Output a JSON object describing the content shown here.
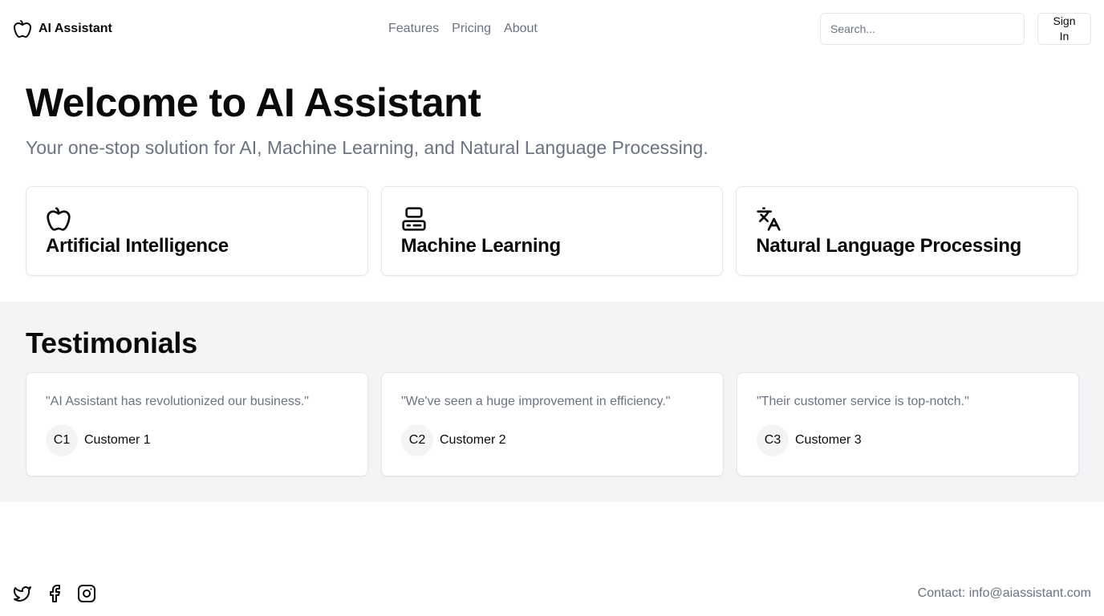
{
  "header": {
    "brand_name": "AI Assistant",
    "brand_icon": "apple-icon",
    "nav": [
      "Features",
      "Pricing",
      "About"
    ],
    "search_placeholder": "Search...",
    "signin_label": "Sign In"
  },
  "hero": {
    "title": "Welcome to AI Assistant",
    "subtitle": "Your one-stop solution for AI, Machine Learning, and Natural Language Processing."
  },
  "features": [
    {
      "icon": "apple-icon",
      "title": "Artificial Intelligence"
    },
    {
      "icon": "computer-icon",
      "title": "Machine Learning"
    },
    {
      "icon": "translate-icon",
      "title": "Natural Language Processing"
    }
  ],
  "testimonials": {
    "title": "Testimonials",
    "items": [
      {
        "quote": "\"AI Assistant has revolutionized our business.\"",
        "initials": "C1",
        "name": "Customer 1"
      },
      {
        "quote": "\"We've seen a huge improvement in efficiency.\"",
        "initials": "C2",
        "name": "Customer 2"
      },
      {
        "quote": "\"Their customer service is top-notch.\"",
        "initials": "C3",
        "name": "Customer 3"
      }
    ]
  },
  "footer": {
    "socials": [
      "twitter-icon",
      "facebook-icon",
      "instagram-icon"
    ],
    "contact": "Contact: info@aiassistant.com"
  },
  "colors": {
    "text": "#0a0a0a",
    "muted": "#6b7280",
    "border": "#e5e7eb",
    "section_bg": "#f3f4f6"
  }
}
